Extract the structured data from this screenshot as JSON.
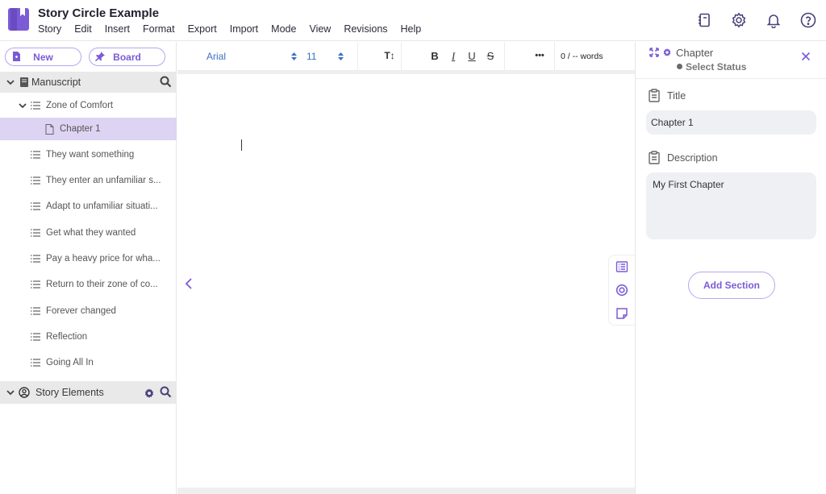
{
  "app": {
    "title": "Story Circle Example",
    "menu": [
      "Story",
      "Edit",
      "Insert",
      "Format",
      "Export",
      "Import",
      "Mode",
      "View",
      "Revisions",
      "Help"
    ],
    "header_icons": [
      "notebook-icon",
      "settings-icon",
      "notifications-icon",
      "help-icon"
    ]
  },
  "colors": {
    "accent": "#7b5bd6",
    "accent_border": "#b9a5ee",
    "selected_bg": "#ddd3f2",
    "section_bg": "#e9e9e9",
    "font_select": "#3a6fc4"
  },
  "sidebar": {
    "new_label": "New",
    "board_label": "Board",
    "manuscript": {
      "label": "Manuscript",
      "items": [
        {
          "label": "Zone of Comfort",
          "type": "section",
          "expanded": true
        },
        {
          "label": "Chapter 1",
          "type": "chapter",
          "selected": true
        },
        {
          "label": "They want something",
          "type": "section"
        },
        {
          "label": "They enter an unfamiliar s...",
          "type": "section"
        },
        {
          "label": "Adapt to unfamiliar situati...",
          "type": "section"
        },
        {
          "label": "Get what they wanted",
          "type": "section"
        },
        {
          "label": "Pay a heavy price for wha...",
          "type": "section"
        },
        {
          "label": "Return to their zone of co...",
          "type": "section"
        },
        {
          "label": "Forever changed",
          "type": "section"
        },
        {
          "label": "Reflection",
          "type": "section"
        },
        {
          "label": "Going All In",
          "type": "section"
        }
      ]
    },
    "story_elements": {
      "label": "Story Elements"
    }
  },
  "toolbar": {
    "font": "Arial",
    "size": "11",
    "text_size_icon": "T↕",
    "bold": "B",
    "italic": "I",
    "underline": "U",
    "strike": "S",
    "more": "•••",
    "word_count": "0 / -- words"
  },
  "panel": {
    "title": "Chapter",
    "status": "Select Status",
    "title_label": "Title",
    "title_value": "Chapter 1",
    "description_label": "Description",
    "description_value": "My First Chapter",
    "add_section_label": "Add Section"
  }
}
